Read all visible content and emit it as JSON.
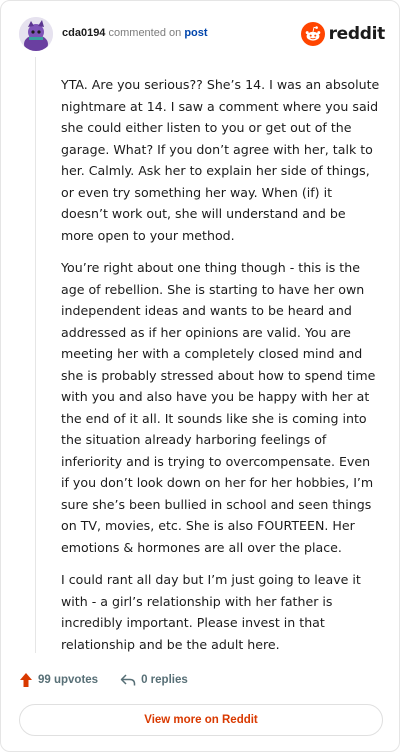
{
  "header": {
    "username": "cda0194",
    "action_text": "commented on",
    "target_text": "post",
    "brand_name": "reddit",
    "brand_color": "#ff4500",
    "avatar_icon": "avatar-icon"
  },
  "comment": {
    "paragraphs": [
      "YTA. Are you serious?? She’s 14. I was an absolute nightmare at 14. I saw a comment where you said she could either listen to you or get out of the garage. What? If you don’t agree with her, talk to her. Calmly. Ask her to explain her side of things, or even try something her way. When (if) it doesn’t work out, she will understand and be more open to your method.",
      "You’re right about one thing though - this is the age of rebellion. She is starting to have her own independent ideas and wants to be heard and addressed as if her opinions are valid. You are meeting her with a completely closed mind and she is probably stressed about how to spend time with you and also have you be happy with her at the end of it all. It sounds like she is coming into the situation already harboring feelings of inferiority and is trying to overcompensate. Even if you don’t look down on her for her hobbies, I’m sure she’s been bullied in school and seen things on TV, movies, etc. She is also FOURTEEN. Her emotions & hormones are all over the place.",
      "I could rant all day but I’m just going to leave it with - a girl’s relationship with her father is incredibly important. Please invest in that relationship and be the adult here."
    ]
  },
  "footer": {
    "upvotes_label": "99 upvotes",
    "replies_label": "0 replies",
    "upvote_color": "#d93900"
  },
  "view_more_label": "View more on Reddit"
}
